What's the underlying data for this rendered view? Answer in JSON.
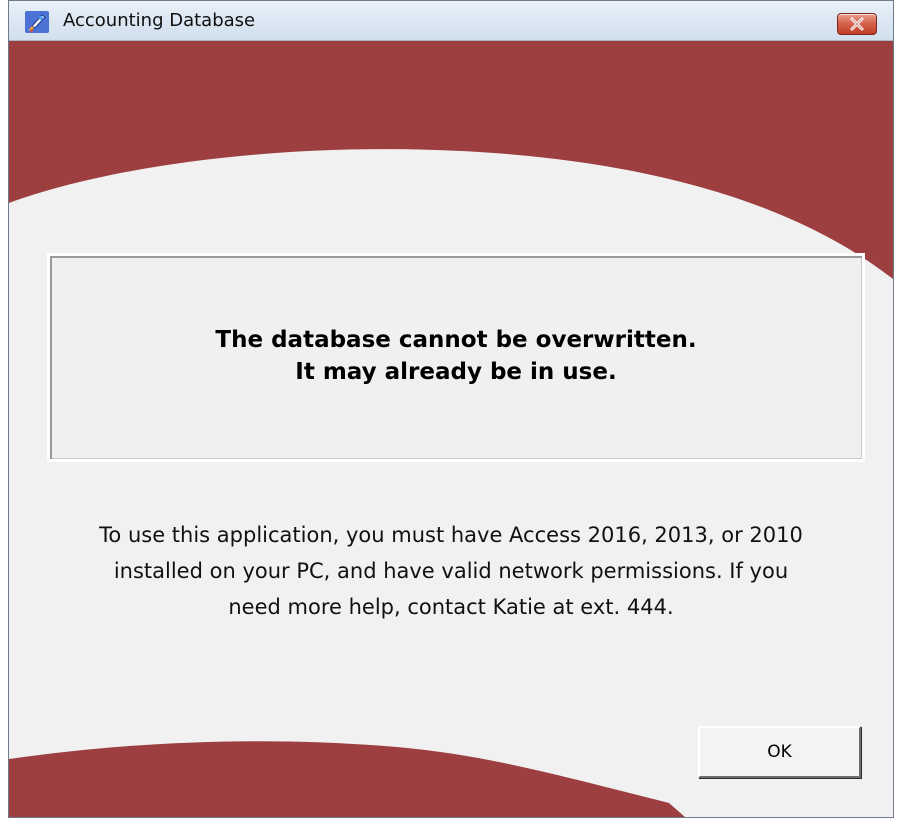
{
  "window": {
    "title": "Accounting Database"
  },
  "message": {
    "line1": "The database cannot be overwritten.",
    "line2": "It may already be in use."
  },
  "help": {
    "line1": "To use this application, you must have Access 2016, 2013, or 2010",
    "line2": "installed on your PC, and have valid network permissions. If you",
    "line3": "need more help, contact Katie at ext. 444."
  },
  "buttons": {
    "ok": "OK"
  },
  "icons": {
    "app": "rocket-icon",
    "close": "close-icon"
  },
  "colors": {
    "accent_red": "#9d3f40",
    "background": "#f1f1f1",
    "title_bar": "#dbe6f2"
  }
}
